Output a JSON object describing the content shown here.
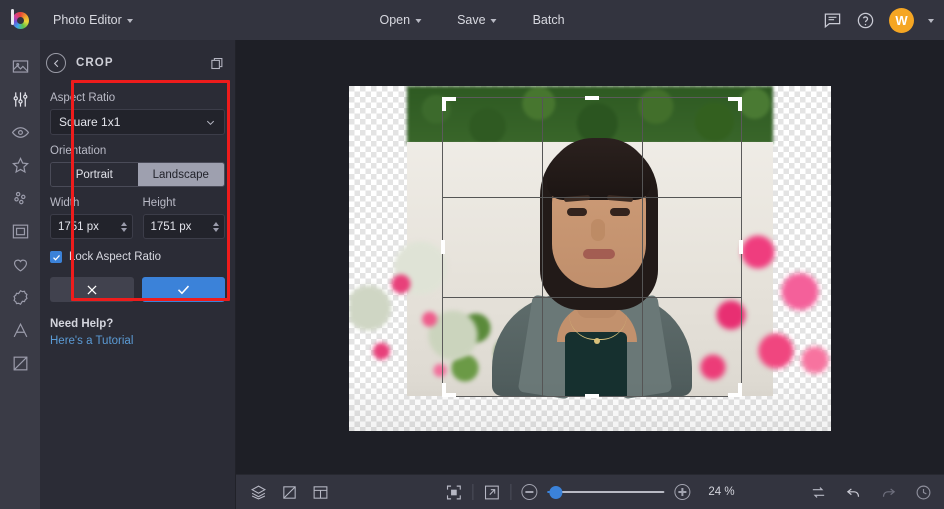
{
  "topbar": {
    "logo_icon": "color-wheel-logo",
    "app_name": "Photo Editor",
    "open_label": "Open",
    "save_label": "Save",
    "batch_label": "Batch",
    "feedback_icon": "comment-icon",
    "help_icon": "question-circle-icon",
    "avatar_initial": "W",
    "avatar_color": "#f5a623",
    "account_caret_icon": "chevron-down-icon"
  },
  "rail": {
    "items": [
      {
        "icon": "image-icon",
        "name": "sidebar-item-image"
      },
      {
        "icon": "sliders-icon",
        "name": "sidebar-item-adjust"
      },
      {
        "icon": "eye-icon",
        "name": "sidebar-item-retouch"
      },
      {
        "icon": "star-icon",
        "name": "sidebar-item-effects"
      },
      {
        "icon": "dots-cluster-icon",
        "name": "sidebar-item-overlays"
      },
      {
        "icon": "frame-icon",
        "name": "sidebar-item-frames"
      },
      {
        "icon": "heart-icon",
        "name": "sidebar-item-favorites"
      },
      {
        "icon": "badge-icon",
        "name": "sidebar-item-stickers"
      },
      {
        "icon": "text-a-icon",
        "name": "sidebar-item-text"
      },
      {
        "icon": "crop-diagonal-icon",
        "name": "sidebar-item-crop"
      }
    ]
  },
  "panel": {
    "back_icon": "arrow-left-circle-icon",
    "title": "CROP",
    "duplicate_icon": "stacked-squares-icon",
    "aspect_ratio_label": "Aspect Ratio",
    "aspect_ratio_value": "Square 1x1",
    "aspect_ratio_caret": "chevron-down-icon",
    "orientation_label": "Orientation",
    "orientation_portrait": "Portrait",
    "orientation_landscape": "Landscape",
    "orientation_selected": "Landscape",
    "width_label": "Width",
    "width_value": "1751 px",
    "height_label": "Height",
    "height_value": "1751 px",
    "lock_label": "Lock Aspect Ratio",
    "lock_checked": true,
    "cancel_icon": "close-x-icon",
    "apply_icon": "checkmark-icon",
    "accent_color": "#3b82d9",
    "help_title": "Need Help?",
    "help_link": "Here's a Tutorial"
  },
  "annotation": {
    "color": "#ee1c1c",
    "name": "crop-settings-highlight"
  },
  "canvas": {
    "photo_alt": "portrait-photo",
    "crop_overlay": "rule-of-thirds-crop-overlay"
  },
  "bottombar": {
    "layers_icon": "layers-icon",
    "crop_icon": "crop-icon",
    "panels_icon": "panel-layout-icon",
    "fit_icon": "fit-to-screen-icon",
    "fullscreen_icon": "expand-arrow-icon",
    "zoom_out_icon": "minus-circle-icon",
    "zoom_in_icon": "plus-circle-icon",
    "zoom_value": "24 %",
    "compare_icon": "compare-swap-icon",
    "undo_icon": "undo-arrow-icon",
    "redo_icon": "redo-arrow-icon",
    "history_icon": "history-clock-icon"
  }
}
